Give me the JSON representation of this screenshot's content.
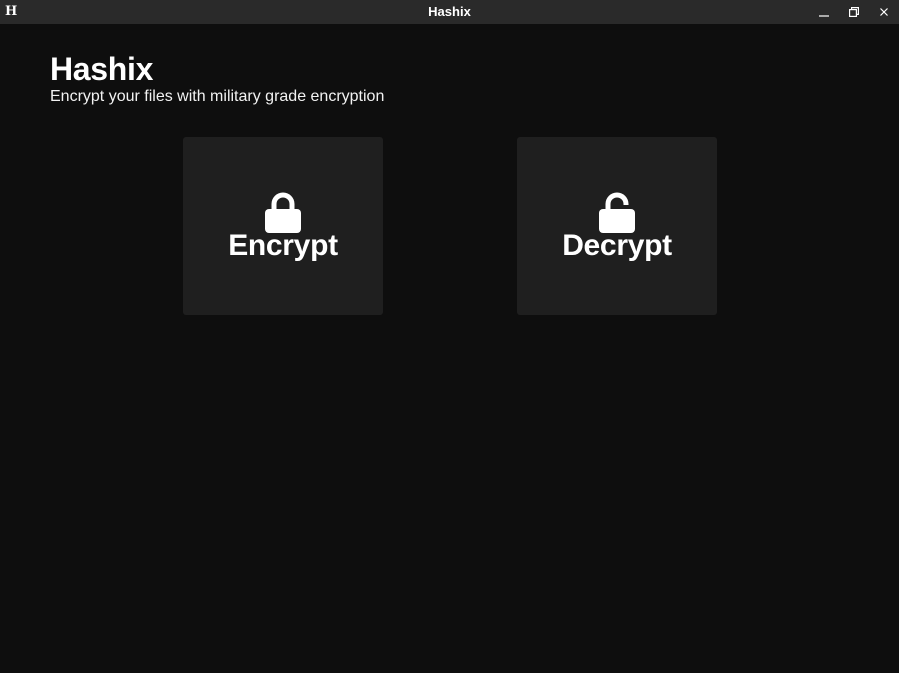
{
  "window": {
    "logo_text": "H",
    "title": "Hashix"
  },
  "header": {
    "title": "Hashix",
    "subtitle": "Encrypt your files with military grade encryption"
  },
  "actions": [
    {
      "label": "Encrypt",
      "icon": "lock-icon"
    },
    {
      "label": "Decrypt",
      "icon": "unlock-icon"
    }
  ],
  "colors": {
    "background": "#0e0e0e",
    "titlebar": "#2a2a2a",
    "card": "#1f1f1f",
    "text": "#ffffff"
  }
}
